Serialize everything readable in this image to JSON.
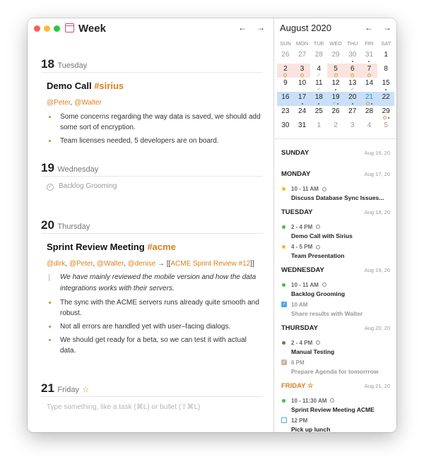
{
  "window": {
    "title": "Week",
    "traffic": {
      "close": "#fe5f57",
      "minimize": "#febc2e",
      "zoom": "#28c840"
    },
    "accent": "#d9801e",
    "prev": "←",
    "next": "→"
  },
  "days": [
    {
      "num": "18",
      "name": "Tuesday",
      "note": {
        "title": "Demo Call",
        "tag": "#sirius",
        "mentions": [
          "@Peter",
          "@Walter"
        ],
        "bullets": [
          "Some concerns regarding the way data is saved, we should add some sort of encryption.",
          "Team licenses needed, 5 developers are on board."
        ]
      }
    },
    {
      "num": "19",
      "name": "Wednesday",
      "task": "Backlog Grooming"
    },
    {
      "num": "20",
      "name": "Thursday",
      "note": {
        "title": "Sprint Review Meeting",
        "tag": "#acme",
        "mentions": [
          "@dirk",
          "@Peter",
          "@Walter",
          "@denise"
        ],
        "link_arrow": "→ [[",
        "link": "ACME Sprint Review #12",
        "link_close": "]]",
        "quote": "We have mainly reviewed the mobile version and how the data integrations works with their servers.",
        "bullets": [
          "The sync with the ACME servers runs already quite smooth and robust.",
          "Not all errors are handled yet with user–facing dialogs.",
          "We should get ready for a beta, so we can test it with actual data."
        ]
      }
    },
    {
      "num": "21",
      "name": "Friday",
      "star": "☆",
      "placeholder": "Type something, like a task (⌘L) or bullet (⇧⌘L)"
    }
  ],
  "calendar": {
    "month": "August 2020",
    "prev": "←",
    "next": "→",
    "weekdays": [
      "SUN",
      "MON",
      "TUE",
      "WED",
      "THU",
      "FRI",
      "SAT"
    ],
    "weeks": [
      {
        "days": [
          {
            "d": "26",
            "muted": true
          },
          {
            "d": "27",
            "muted": true
          },
          {
            "d": "28",
            "muted": true
          },
          {
            "d": "29",
            "muted": true
          },
          {
            "d": "30",
            "muted": true,
            "marks": [
              "dot"
            ]
          },
          {
            "d": "31",
            "muted": true,
            "marks": [
              "dot"
            ]
          },
          {
            "d": "1"
          }
        ]
      },
      {
        "days": [
          {
            "d": "2",
            "pink": true,
            "marks": [
              "circle"
            ]
          },
          {
            "d": "3",
            "pink": true,
            "marks": [
              "circle"
            ]
          },
          {
            "d": "4",
            "marks": [
              "check"
            ]
          },
          {
            "d": "5",
            "pink": true,
            "marks": [
              "circle"
            ]
          },
          {
            "d": "6",
            "pink": true,
            "marks": [
              "circle"
            ]
          },
          {
            "d": "7",
            "pink": true,
            "marks": [
              "circle"
            ]
          },
          {
            "d": "8"
          }
        ]
      },
      {
        "days": [
          {
            "d": "9"
          },
          {
            "d": "10"
          },
          {
            "d": "11",
            "marks": [
              "check"
            ]
          },
          {
            "d": "12",
            "marks": [
              "dot"
            ]
          },
          {
            "d": "13",
            "marks": [
              "check"
            ]
          },
          {
            "d": "14"
          },
          {
            "d": "15",
            "marks": [
              "dot"
            ]
          }
        ]
      },
      {
        "selected": true,
        "days": [
          {
            "d": "16"
          },
          {
            "d": "17",
            "marks": [
              "dot"
            ]
          },
          {
            "d": "18",
            "marks": [
              "dot"
            ]
          },
          {
            "d": "19",
            "marks": [
              "check",
              "dot"
            ]
          },
          {
            "d": "20",
            "marks": [
              "dot"
            ]
          },
          {
            "d": "21",
            "today": true,
            "marks": [
              "circle",
              "dot"
            ]
          },
          {
            "d": "22"
          }
        ]
      },
      {
        "days": [
          {
            "d": "23"
          },
          {
            "d": "24"
          },
          {
            "d": "25"
          },
          {
            "d": "26"
          },
          {
            "d": "27"
          },
          {
            "d": "28"
          },
          {
            "d": "29",
            "marks": [
              "circle",
              "dot"
            ]
          }
        ]
      },
      {
        "days": [
          {
            "d": "30"
          },
          {
            "d": "31"
          },
          {
            "d": "1",
            "muted": true
          },
          {
            "d": "2",
            "muted": true
          },
          {
            "d": "3",
            "muted": true
          },
          {
            "d": "4",
            "muted": true
          },
          {
            "d": "5",
            "muted": true
          }
        ]
      }
    ]
  },
  "agenda": [
    {
      "day": "SUNDAY",
      "date": "Aug 16, 20",
      "items": []
    },
    {
      "day": "MONDAY",
      "date": "Aug 17, 20",
      "items": [
        {
          "kind": "event",
          "color": "#f5b921",
          "time": "10 - 11 AM",
          "alarm": true,
          "title": "Discuss Database Sync Issues..."
        }
      ]
    },
    {
      "day": "TUESDAY",
      "date": "Aug 18, 20",
      "items": [
        {
          "kind": "event",
          "color": "#3cbf4a",
          "time": "2 - 4 PM",
          "alarm": true,
          "title": "Demo Call with Sirius"
        },
        {
          "kind": "event",
          "color": "#f5b921",
          "time": "4 - 5 PM",
          "alarm": true,
          "title": "Team Presentation"
        }
      ]
    },
    {
      "day": "WEDNESDAY",
      "date": "Aug 19, 20",
      "items": [
        {
          "kind": "event",
          "color": "#3cbf4a",
          "time": "10 - 11 AM",
          "alarm": true,
          "title": "Backlog Grooming"
        },
        {
          "kind": "task",
          "done": true,
          "color": "#48a9e8",
          "time": "10 AM",
          "title": "Share results with Walter"
        }
      ]
    },
    {
      "day": "THURSDAY",
      "date": "Aug 20, 20",
      "items": [
        {
          "kind": "event",
          "color": "#8b6a4f",
          "time": "2 - 4 PM",
          "alarm": true,
          "title": "Manual Testing"
        },
        {
          "kind": "task",
          "done": true,
          "color": "#c9b9a6",
          "time": "6 PM",
          "title": "Prepare Agenda for tomorrrow"
        }
      ]
    },
    {
      "day": "FRIDAY",
      "star": "☆",
      "today": true,
      "date": "Aug 21, 20",
      "items": [
        {
          "kind": "event",
          "color": "#3cbf4a",
          "time": "10 - 11:30 AM",
          "alarm": true,
          "title": "Sprint Review Meeting ACME"
        },
        {
          "kind": "task",
          "done": false,
          "color": "#48a9e8",
          "time": "12 PM",
          "title": "Pick up lunch"
        }
      ]
    }
  ]
}
